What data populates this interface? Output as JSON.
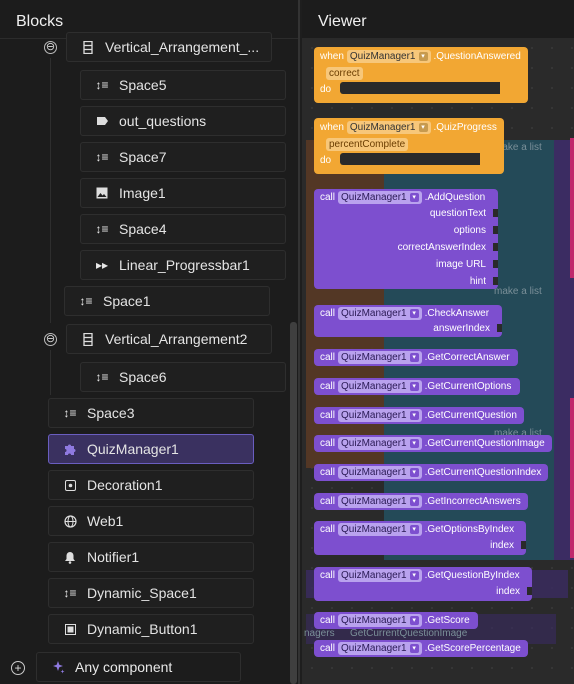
{
  "blocks_panel": {
    "title": "Blocks",
    "tree": [
      {
        "label": "Vertical_Arrangement_...",
        "icon": "vertical-arrangement-icon",
        "collapse": "⊖"
      },
      {
        "label": "Space5",
        "icon": "spacer-icon"
      },
      {
        "label": "out_questions",
        "icon": "label-icon"
      },
      {
        "label": "Space7",
        "icon": "spacer-icon"
      },
      {
        "label": "Image1",
        "icon": "image-icon"
      },
      {
        "label": "Space4",
        "icon": "spacer-icon"
      },
      {
        "label": "Linear_Progressbar1",
        "icon": "progressbar-icon"
      },
      {
        "label": "Space1",
        "icon": "spacer-icon"
      },
      {
        "label": "Vertical_Arrangement2",
        "icon": "vertical-arrangement-icon",
        "collapse": "⊖"
      },
      {
        "label": "Space6",
        "icon": "spacer-icon"
      },
      {
        "label": "Space3",
        "icon": "spacer-icon"
      },
      {
        "label": "QuizManager1",
        "icon": "extension-puzzle-icon",
        "selected": true
      },
      {
        "label": "Decoration1",
        "icon": "decoration-icon"
      },
      {
        "label": "Web1",
        "icon": "globe-icon"
      },
      {
        "label": "Notifier1",
        "icon": "bell-icon"
      },
      {
        "label": "Dynamic_Space1",
        "icon": "spacer-icon"
      },
      {
        "label": "Dynamic_Button1",
        "icon": "button-icon"
      }
    ],
    "any_component": "Any component"
  },
  "viewer": {
    "title": "Viewer",
    "faded_texts": [
      "make a list",
      "make a list",
      "make a list",
      "nagers",
      "GetCurrentQuestionImage"
    ],
    "events": [
      {
        "when": "when",
        "component": "QuizManager1",
        "event": ".QuestionAnswered",
        "params": [
          "correct"
        ],
        "do": "do"
      },
      {
        "when": "when",
        "component": "QuizManager1",
        "event": ".QuizProgress",
        "params": [
          "percentComplete"
        ],
        "do": "do"
      }
    ],
    "calls": [
      {
        "call": "call",
        "component": "QuizManager1",
        "method": ".AddQuestion",
        "args": [
          "questionText",
          "options",
          "correctAnswerIndex",
          "image URL",
          "hint"
        ]
      },
      {
        "call": "call",
        "component": "QuizManager1",
        "method": ".CheckAnswer",
        "args": [
          "answerIndex"
        ]
      },
      {
        "call": "call",
        "component": "QuizManager1",
        "method": ".GetCorrectAnswer",
        "args": []
      },
      {
        "call": "call",
        "component": "QuizManager1",
        "method": ".GetCurrentOptions",
        "args": []
      },
      {
        "call": "call",
        "component": "QuizManager1",
        "method": ".GetCurrentQuestion",
        "args": []
      },
      {
        "call": "call",
        "component": "QuizManager1",
        "method": ".GetCurrentQuestionImage",
        "args": []
      },
      {
        "call": "call",
        "component": "QuizManager1",
        "method": ".GetCurrentQuestionIndex",
        "args": []
      },
      {
        "call": "call",
        "component": "QuizManager1",
        "method": ".GetIncorrectAnswers",
        "args": []
      },
      {
        "call": "call",
        "component": "QuizManager1",
        "method": ".GetOptionsByIndex",
        "args": [
          "index"
        ]
      },
      {
        "call": "call",
        "component": "QuizManager1",
        "method": ".GetQuestionByIndex",
        "args": [
          "index"
        ]
      },
      {
        "call": "call",
        "component": "QuizManager1",
        "method": ".GetScore",
        "args": []
      },
      {
        "call": "call",
        "component": "QuizManager1",
        "method": ".GetScorePercentage",
        "args": []
      }
    ],
    "colors": {
      "event_block": "#f2a733",
      "method_block": "#7d4fcf",
      "selected": "#3a3160"
    }
  }
}
